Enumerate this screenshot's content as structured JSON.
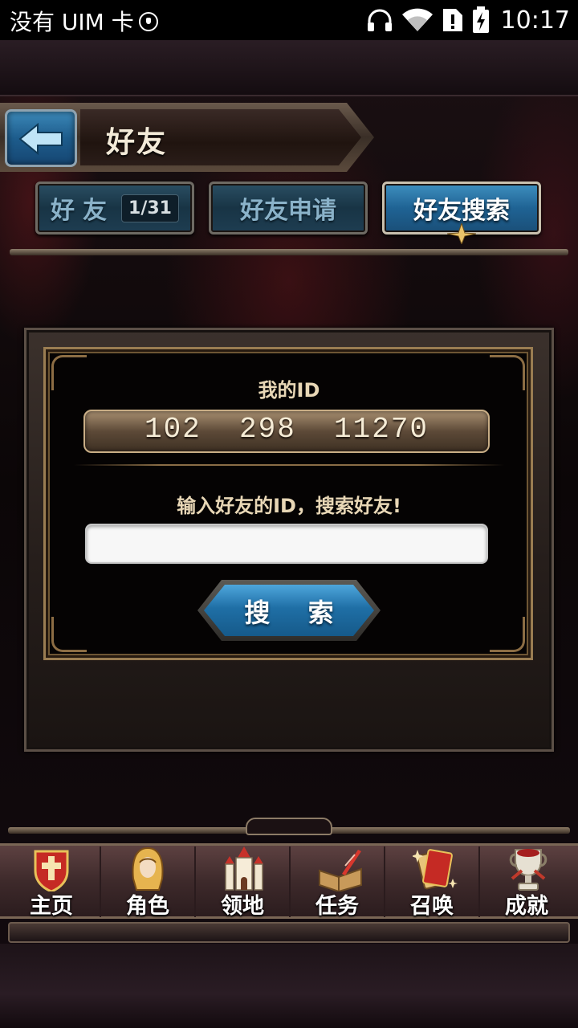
{
  "status_bar": {
    "carrier": "没有 UIM 卡",
    "time": "10:17",
    "icons": [
      "headphones-icon",
      "wifi-icon",
      "sim-alert-icon",
      "battery-charging-icon"
    ]
  },
  "header": {
    "title": "好友",
    "back_icon": "back-arrow-icon"
  },
  "tabs": [
    {
      "label": "好友",
      "badge": "1/31",
      "active": false
    },
    {
      "label": "好友申请",
      "active": false
    },
    {
      "label": "好友搜索",
      "active": true
    }
  ],
  "panel": {
    "my_id_label": "我的ID",
    "my_id_value": "102  298  11270",
    "prompt": "输入好友的ID，搜索好友!",
    "search_input_value": "",
    "search_button": "搜 索"
  },
  "bottom_nav": [
    {
      "label": "主页",
      "icon": "shield-cross-icon"
    },
    {
      "label": "角色",
      "icon": "hooded-character-icon"
    },
    {
      "label": "领地",
      "icon": "castle-icon"
    },
    {
      "label": "任务",
      "icon": "quest-book-icon"
    },
    {
      "label": "召唤",
      "icon": "summon-card-icon"
    },
    {
      "label": "成就",
      "icon": "trophy-icon"
    }
  ],
  "colors": {
    "accent_blue": "#1f6fa6",
    "gold_text": "#e8d7b6",
    "panel_gold": "#9a7d52"
  }
}
